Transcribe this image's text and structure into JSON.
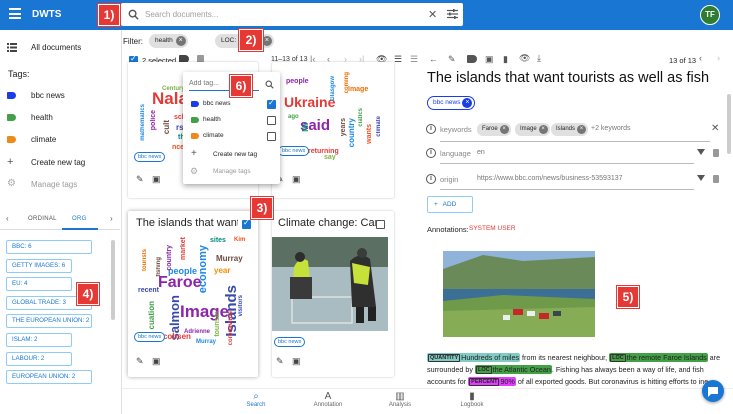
{
  "app": {
    "title": "DWTS",
    "user_initials": "TF",
    "brand_color": "#1976d2"
  },
  "search": {
    "placeholder": "Search documents..."
  },
  "callouts": [
    "1)",
    "2)",
    "3)",
    "4)",
    "5)",
    "6)"
  ],
  "sidebar": {
    "all_documents": "All documents",
    "tags_heading": "Tags:",
    "tags": [
      {
        "label": "bbc news",
        "color": "#1a3de8"
      },
      {
        "label": "health",
        "color": "#43a047"
      },
      {
        "label": "climate",
        "color": "#ef8a1a"
      }
    ],
    "create_tag": "Create new tag",
    "manage_tags": "Manage tags",
    "tabs": [
      "ORDINAL",
      "ORG"
    ],
    "entities": [
      "BBC: 6",
      "GETTY IMAGES: 6",
      "EU: 4",
      "GLOBAL TRADE: 3",
      "THE EUROPEAN UNION: 2",
      "ISLAM: 2",
      "LABOUR: 2",
      "EUROPEAN UNION: 2"
    ]
  },
  "filter": {
    "label": "Filter:",
    "chips": [
      "health",
      "LOC: Europe"
    ]
  },
  "toolbar": {
    "selected": "2 selected",
    "range": "11–13 of 13"
  },
  "cards": [
    {
      "title": "The islands that want",
      "tag": "bbc news",
      "checked": true
    },
    {
      "title": "Climate change: Carbo",
      "tag": "bbc news",
      "checked": false
    },
    {
      "tag": "bbc news"
    },
    {
      "tag": "bbc news"
    }
  ],
  "wordclouds": {
    "nalan": [
      "Nalan",
      "Century",
      "mathematics",
      "police",
      "sch",
      "cult",
      "rs",
      "the",
      "nce"
    ],
    "ukraine": [
      "people",
      "Ukraine",
      "said",
      "Image",
      "Mr",
      "Glasgow",
      "years",
      "country",
      "ciatics",
      "returning",
      "say",
      "wants",
      "coming",
      "climate",
      "ago"
    ],
    "faroe": [
      "Faroe",
      "Image",
      "Islands",
      "salmon",
      "people",
      "country",
      "economy",
      "market",
      "year",
      "Murray",
      "Jacobsen",
      "Adrienne",
      "recent",
      "tourism",
      "coronavirus",
      "cuation",
      "tourists",
      "sites",
      "visitors",
      "fishing",
      "Kim",
      "Murray"
    ]
  },
  "tag_menu": {
    "placeholder": "Add tag...",
    "items": [
      {
        "label": "bbc news",
        "color": "#1a3de8",
        "checked": true
      },
      {
        "label": "health",
        "color": "#43a047",
        "checked": false
      },
      {
        "label": "climate",
        "color": "#ef8a1a",
        "checked": false
      }
    ],
    "create": "Create new tag",
    "manage": "Manage tags"
  },
  "detail": {
    "page": "13 of 13",
    "title": "The islands that want tourists as well as fish",
    "tag": "bbc news",
    "keywords_label": "keywords",
    "keywords": [
      "Faroe",
      "Image",
      "Islands"
    ],
    "keywords_more": "+2 keywords",
    "language_label": "language",
    "language": "en",
    "origin_label": "origin",
    "origin": "https://www.bbc.com/news/business-53593137",
    "add_label": "ADD",
    "annotations_label": "Annotations:",
    "annotations_user": "SYSTEM USER",
    "text": {
      "q_label": "QUANTITY",
      "q_text": "Hundreds of miles",
      "t1": " from its nearest neighbour, ",
      "loc1_label": "LOC",
      "loc1_text": "the remote Faroe Islands",
      "t2": " are surrounded by ",
      "loc2_label": "LOC",
      "loc2_text": "the Atlantic Ocean",
      "t3": ". Fishing has always been a way of life, and fish accounts for ",
      "pct_label": "PERCENT",
      "pct_text": "90%",
      "t4": " of all exported goods. But coronavirus is hitting efforts to in",
      "t5": "e"
    },
    "colors": {
      "quantity": "#80cbc4",
      "loc": "#43a047",
      "percent": "#e040fb"
    }
  },
  "bottom_nav": [
    "Search",
    "Annotation",
    "Analysis",
    "Logbook"
  ]
}
